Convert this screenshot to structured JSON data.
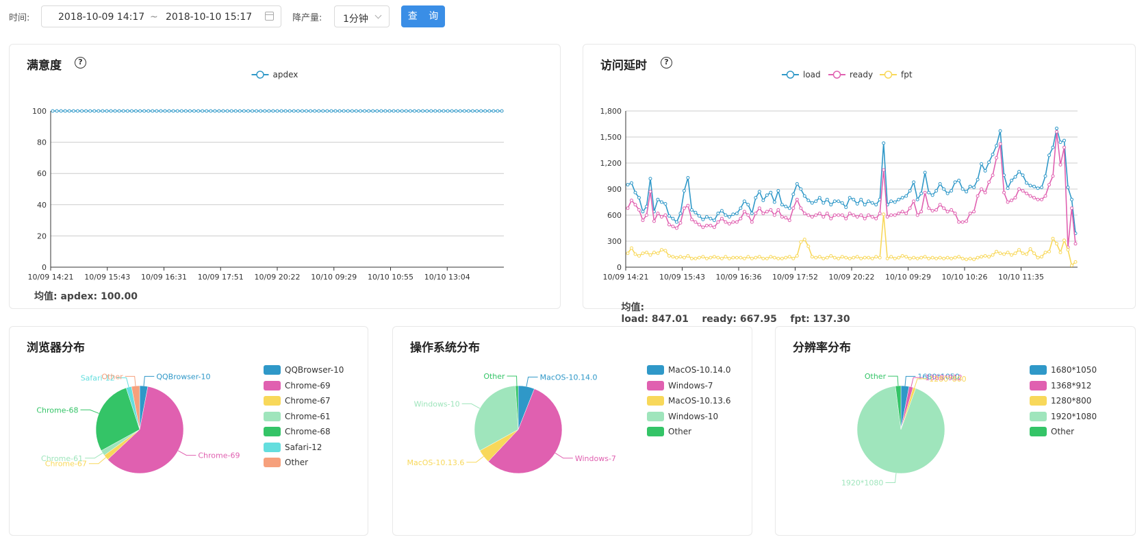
{
  "toolbar": {
    "time_label": "时间:",
    "start": "2018-10-09 14:17",
    "sep": "~",
    "end": "2018-10-10 15:17",
    "downsample_label": "降产量:",
    "downsample_value": "1分钟",
    "query_label": "查 询"
  },
  "cards": {
    "satisfaction": {
      "title": "满意度",
      "mean_label": "均值:",
      "mean_text": "apdex: 100.00"
    },
    "latency": {
      "title": "访问延时",
      "mean_label": "均值:",
      "mean_text": "load: 847.01    ready: 667.95    fpt: 137.30"
    },
    "browser": {
      "title": "浏览器分布"
    },
    "os": {
      "title": "操作系统分布"
    },
    "resolution": {
      "title": "分辨率分布"
    }
  },
  "colors": {
    "blue": "#2f98c8",
    "pink": "#e060b0",
    "yellow": "#f8d85a",
    "mint": "#9fe5bc",
    "green": "#34c467",
    "cyan": "#64dede",
    "salmon": "#f6a07c",
    "accent": "#3a8ee6"
  },
  "chart_data": [
    {
      "type": "line",
      "id": "apdex",
      "legend": [
        "apdex"
      ],
      "x_ticks": [
        "10/09 14:21",
        "10/09 15:43",
        "10/09 16:31",
        "10/09 17:51",
        "10/09 20:22",
        "10/10 09:29",
        "10/10 10:55",
        "10/10 13:04"
      ],
      "y_ticks": [
        0,
        20,
        40,
        60,
        80,
        100
      ],
      "ylim": [
        0,
        100
      ],
      "series": [
        {
          "name": "apdex",
          "color": "#2f98c8",
          "constant": 100,
          "points": 109
        }
      ]
    },
    {
      "type": "line",
      "id": "latency",
      "legend": [
        "load",
        "ready",
        "fpt"
      ],
      "x_ticks": [
        "10/09 14:21",
        "10/09 15:43",
        "10/09 16:36",
        "10/09 17:52",
        "10/09 20:22",
        "10/10 09:29",
        "10/10 10:26",
        "10/10 11:35"
      ],
      "y_ticks": [
        "0",
        "300",
        "600",
        "900",
        "1,200",
        "1,500",
        "1,800"
      ],
      "ylim": [
        0,
        1800
      ],
      "series": [
        {
          "name": "load",
          "color": "#2f98c8",
          "values": [
            950,
            970,
            860,
            800,
            640,
            700,
            1020,
            640,
            780,
            750,
            730,
            590,
            560,
            520,
            620,
            880,
            1030,
            660,
            630,
            590,
            550,
            580,
            560,
            540,
            620,
            650,
            600,
            580,
            610,
            620,
            680,
            760,
            720,
            620,
            800,
            870,
            770,
            830,
            860,
            750,
            880,
            720,
            700,
            680,
            840,
            960,
            900,
            820,
            770,
            740,
            760,
            800,
            740,
            780,
            720,
            760,
            760,
            740,
            690,
            800,
            780,
            730,
            780,
            720,
            760,
            740,
            720,
            780,
            1430,
            720,
            760,
            750,
            780,
            800,
            820,
            880,
            980,
            780,
            850,
            1090,
            860,
            830,
            880,
            960,
            900,
            850,
            880,
            980,
            1000,
            900,
            870,
            930,
            920,
            1010,
            1190,
            1110,
            1210,
            1300,
            1400,
            1570,
            1060,
            910,
            1000,
            1040,
            1100,
            1060,
            970,
            940,
            930,
            910,
            920,
            1050,
            1290,
            1380,
            1600,
            1440,
            1460,
            920,
            780,
            390
          ]
        },
        {
          "name": "ready",
          "color": "#e060b0",
          "values": [
            680,
            770,
            720,
            660,
            540,
            600,
            870,
            530,
            620,
            580,
            600,
            490,
            470,
            450,
            510,
            680,
            710,
            550,
            520,
            490,
            460,
            480,
            480,
            460,
            520,
            560,
            520,
            500,
            520,
            520,
            560,
            640,
            600,
            520,
            620,
            680,
            620,
            640,
            660,
            600,
            660,
            580,
            570,
            540,
            680,
            780,
            680,
            620,
            600,
            580,
            600,
            620,
            580,
            620,
            560,
            600,
            600,
            600,
            560,
            620,
            600,
            580,
            600,
            560,
            600,
            580,
            560,
            620,
            1120,
            580,
            600,
            600,
            620,
            640,
            620,
            680,
            760,
            600,
            640,
            860,
            680,
            650,
            660,
            720,
            680,
            640,
            660,
            620,
            520,
            520,
            530,
            620,
            640,
            820,
            900,
            860,
            980,
            1060,
            1260,
            1420,
            860,
            750,
            770,
            800,
            900,
            880,
            850,
            820,
            800,
            780,
            780,
            820,
            950,
            1050,
            1560,
            1180,
            1380,
            230,
            680,
            270
          ]
        },
        {
          "name": "fpt",
          "color": "#f8d85a",
          "values": [
            160,
            220,
            150,
            130,
            160,
            170,
            140,
            170,
            160,
            200,
            190,
            130,
            120,
            110,
            120,
            110,
            130,
            100,
            100,
            110,
            120,
            100,
            110,
            120,
            110,
            100,
            120,
            100,
            110,
            110,
            110,
            100,
            120,
            100,
            110,
            120,
            100,
            100,
            120,
            110,
            100,
            100,
            110,
            120,
            100,
            130,
            290,
            320,
            240,
            120,
            110,
            120,
            100,
            110,
            130,
            110,
            100,
            120,
            110,
            100,
            110,
            120,
            100,
            110,
            110,
            100,
            120,
            110,
            610,
            100,
            120,
            100,
            110,
            130,
            120,
            100,
            110,
            100,
            110,
            120,
            100,
            110,
            100,
            110,
            100,
            110,
            100,
            110,
            120,
            100,
            90,
            100,
            90,
            110,
            120,
            130,
            120,
            140,
            180,
            160,
            150,
            170,
            140,
            160,
            200,
            160,
            150,
            210,
            160,
            110,
            120,
            170,
            180,
            330,
            270,
            170,
            310,
            200,
            20,
            60
          ]
        }
      ]
    },
    {
      "type": "pie",
      "id": "browser",
      "categories": [
        "QQBrowser-10",
        "Chrome-69",
        "Chrome-67",
        "Chrome-61",
        "Chrome-68",
        "Safari-12",
        "Other"
      ],
      "values": [
        3,
        60,
        2,
        2,
        28,
        2,
        3
      ],
      "colors": [
        "#2f98c8",
        "#e060b0",
        "#f8d85a",
        "#9fe5bc",
        "#34c467",
        "#64dede",
        "#f6a07c"
      ]
    },
    {
      "type": "pie",
      "id": "os",
      "categories": [
        "MacOS-10.14.0",
        "Windows-7",
        "MacOS-10.13.6",
        "Windows-10",
        "Other"
      ],
      "values": [
        6,
        56,
        5,
        32,
        1
      ],
      "colors": [
        "#2f98c8",
        "#e060b0",
        "#f8d85a",
        "#9fe5bc",
        "#34c467"
      ]
    },
    {
      "type": "pie",
      "id": "resolution",
      "categories": [
        "1680*1050",
        "1368*912",
        "1280*800",
        "1920*1080",
        "Other"
      ],
      "values": [
        3,
        1.5,
        1,
        92.5,
        2
      ],
      "colors": [
        "#2f98c8",
        "#e060b0",
        "#f8d85a",
        "#9fe5bc",
        "#34c467"
      ]
    }
  ]
}
